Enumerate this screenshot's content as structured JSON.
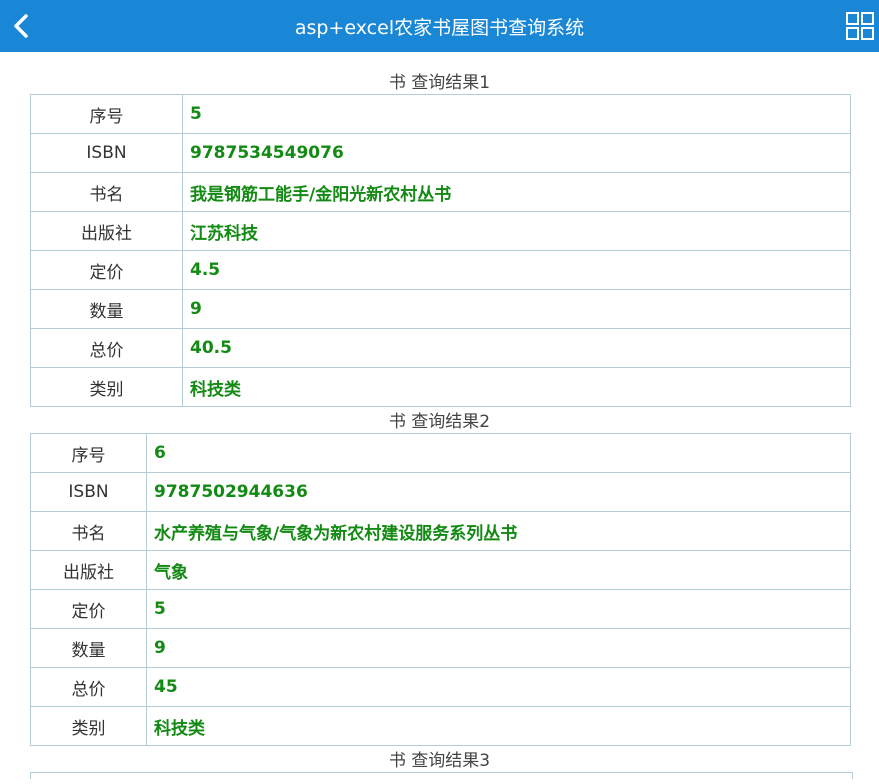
{
  "header": {
    "title": "asp+excel农家书屋图书查询系统"
  },
  "results": [
    {
      "title": "书 查询结果1",
      "rows": [
        {
          "label": "序号",
          "value": "5"
        },
        {
          "label": "ISBN",
          "value": "9787534549076"
        },
        {
          "label": "书名",
          "value": "我是钢筋工能手/金阳光新农村丛书"
        },
        {
          "label": "出版社",
          "value": "江苏科技"
        },
        {
          "label": "定价",
          "value": "4.5"
        },
        {
          "label": "数量",
          "value": "9"
        },
        {
          "label": "总价",
          "value": "40.5"
        },
        {
          "label": "类别",
          "value": "科技类"
        }
      ]
    },
    {
      "title": "书 查询结果2",
      "rows": [
        {
          "label": "序号",
          "value": "6"
        },
        {
          "label": "ISBN",
          "value": "9787502944636"
        },
        {
          "label": "书名",
          "value": "水产养殖与气象/气象为新农村建设服务系列丛书"
        },
        {
          "label": "出版社",
          "value": "气象"
        },
        {
          "label": "定价",
          "value": "5"
        },
        {
          "label": "数量",
          "value": "9"
        },
        {
          "label": "总价",
          "value": "45"
        },
        {
          "label": "类别",
          "value": "科技类"
        }
      ]
    },
    {
      "title": "书 查询结果3",
      "rows": []
    }
  ],
  "icons": {
    "back": "chevron-left-icon",
    "menu": "grid-icon"
  },
  "colors": {
    "header_bg": "#1a87d6",
    "value_text": "#138a13",
    "border": "#b3ccd6"
  }
}
